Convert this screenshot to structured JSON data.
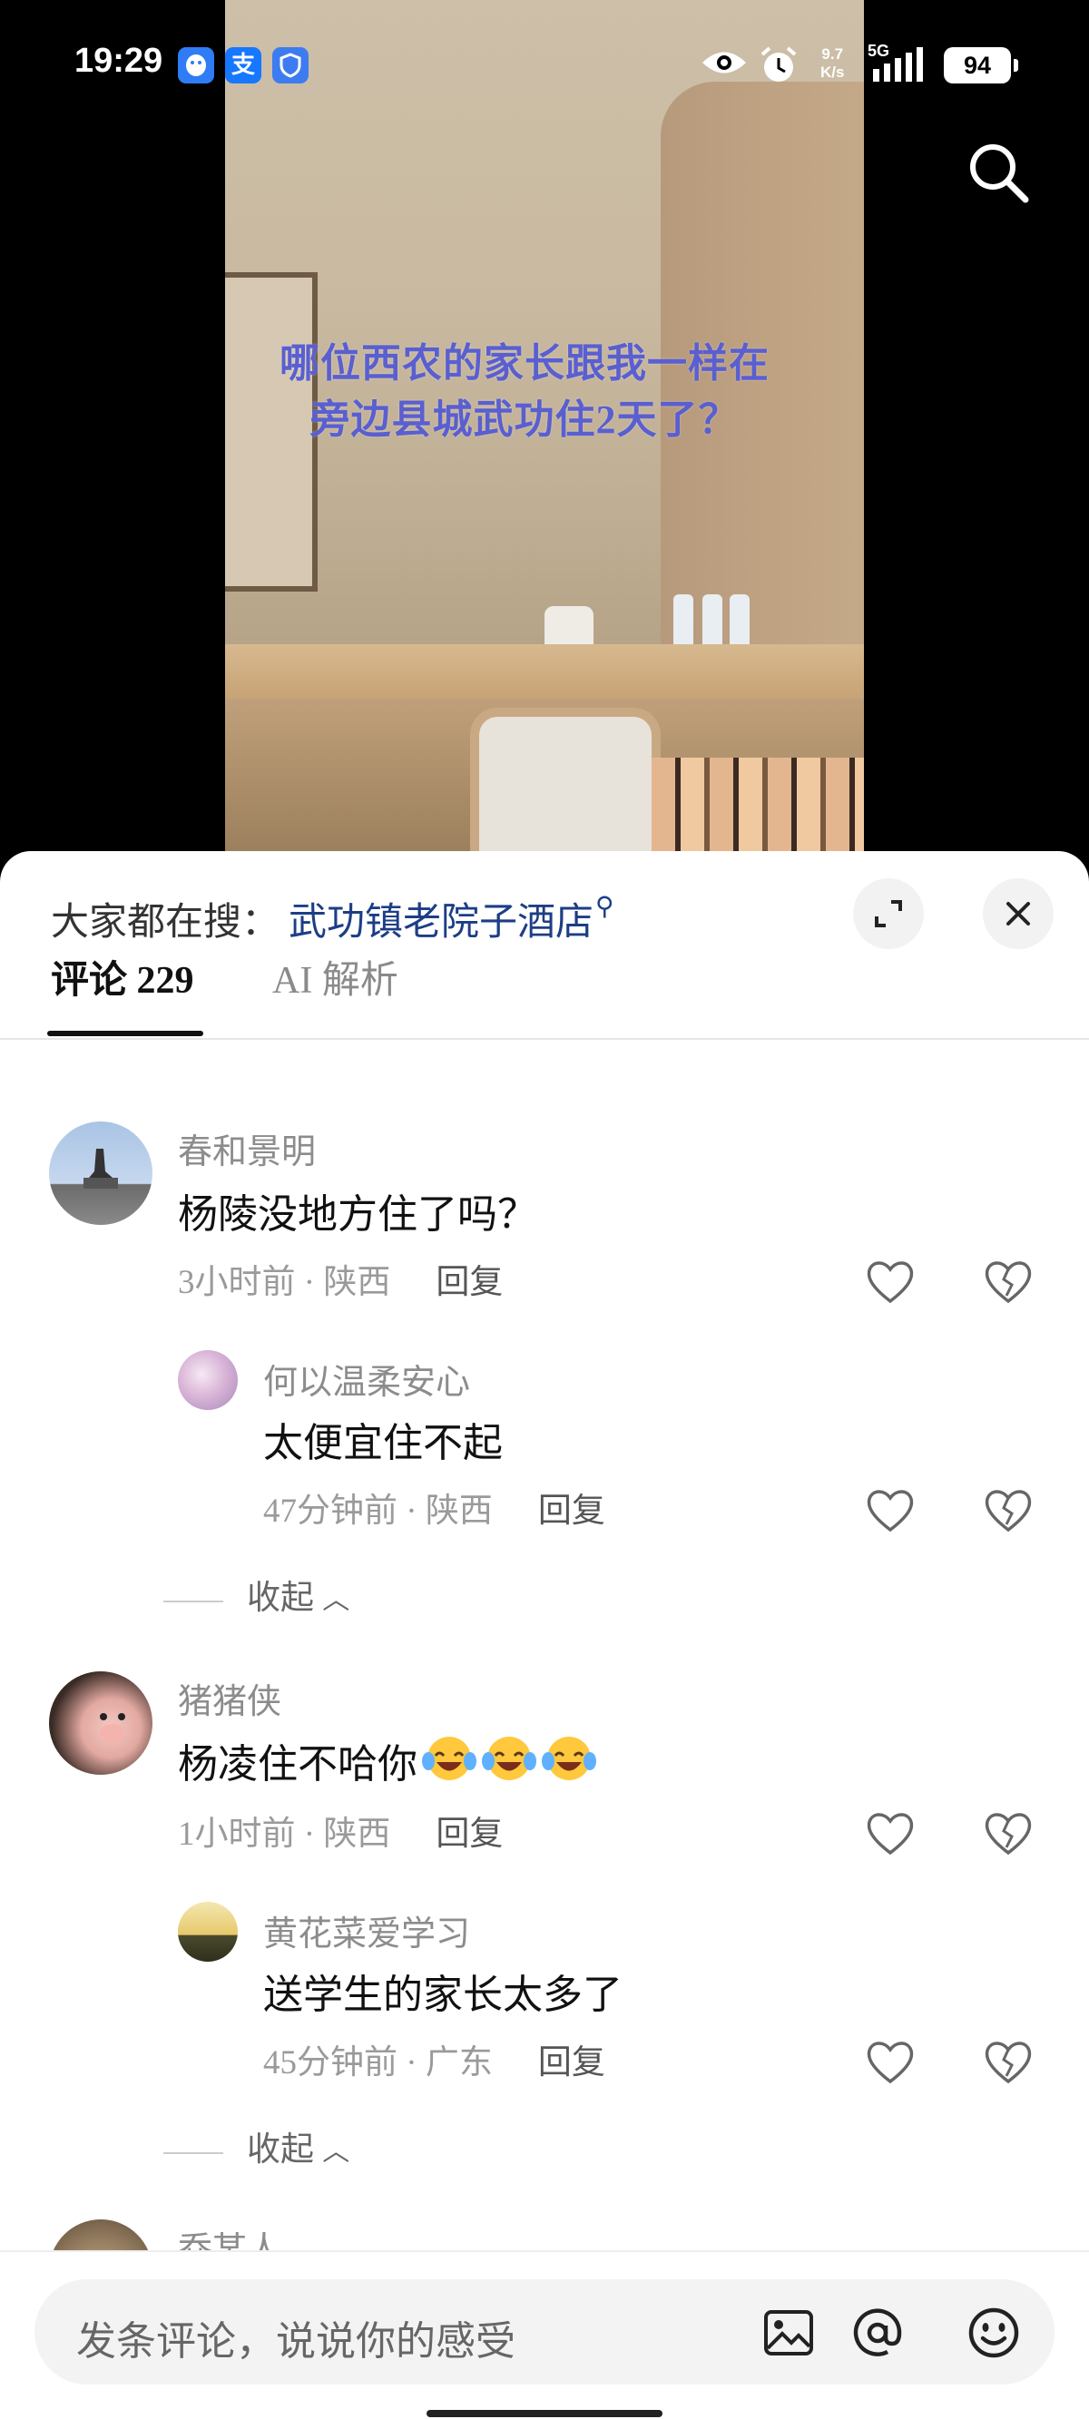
{
  "status_bar": {
    "time": "19:29",
    "apps": [
      {
        "icon": "qq-icon",
        "label": "",
        "color": "#2f7cf6"
      },
      {
        "icon": "alipay-icon",
        "label": "支",
        "color": "#1677ff"
      },
      {
        "icon": "shield-app-icon",
        "label": "",
        "color": "#3d7cf0"
      }
    ],
    "net_speed_value": "9.7",
    "net_speed_unit": "K/s",
    "network": "5G",
    "battery": "94"
  },
  "video": {
    "caption": "哪位西农的家长跟我一样在旁边县城武功住2天了？"
  },
  "sheet": {
    "trending_label": "大家都在搜：",
    "trending_query": "武功镇老院子酒店",
    "tabs": [
      {
        "label": "评论 229",
        "active": true
      },
      {
        "label": "AI 解析",
        "active": false
      }
    ]
  },
  "comments": [
    {
      "user": "春和景明",
      "text": "杨陵没地方住了吗？",
      "time": "3小时前",
      "location": "陕西",
      "reply_label": "回复",
      "replies": [
        {
          "user": "何以温柔安心",
          "text": "太便宜住不起",
          "time": "47分钟前",
          "location": "陕西",
          "reply_label": "回复"
        }
      ],
      "collapse_label": "收起"
    },
    {
      "user": "猪猪侠",
      "text": "杨凌住不哈你",
      "emoji": [
        "laughing-crying-emoji",
        "laughing-crying-emoji",
        "laughing-crying-emoji"
      ],
      "time": "1小时前",
      "location": "陕西",
      "reply_label": "回复",
      "replies": [
        {
          "user": "黄花菜爱学习",
          "text": "送学生的家长太多了",
          "time": "45分钟前",
          "location": "广东",
          "reply_label": "回复"
        }
      ],
      "collapse_label": "收起"
    },
    {
      "user": "乔某人"
    }
  ],
  "bottom_bar": {
    "placeholder": "发条评论，说说你的感受"
  }
}
